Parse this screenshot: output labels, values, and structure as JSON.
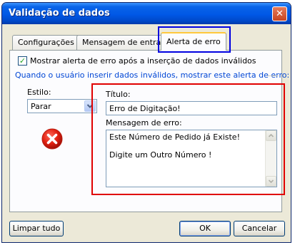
{
  "window": {
    "title": "Validação de dados",
    "close_symbol": "✕"
  },
  "tabs": [
    {
      "label": "Configurações",
      "active": false
    },
    {
      "label": "Mensagem de entrada",
      "active": false
    },
    {
      "label": "Alerta de erro",
      "active": true
    }
  ],
  "error_alert": {
    "checkbox_label": "Mostrar alerta de erro após a inserção de dados inválidos",
    "checkbox_checked": true,
    "group_caption": "Quando o usuário inserir dados inválidos, mostrar este alerta de erro:",
    "style_label": "Estilo:",
    "style_value": "Parar",
    "title_label": "Título:",
    "title_value": "Erro de Digitação!",
    "message_label": "Mensagem de erro:",
    "message_lines": [
      "Este Número de Pedido já Existe!",
      "Digite um Outro Número !"
    ]
  },
  "buttons": {
    "clear_all": "Limpar tudo",
    "ok": "OK",
    "cancel": "Cancelar"
  },
  "colors": {
    "highlight_red": "#e00000",
    "highlight_blue": "#0000e0",
    "title_bar": "#0058e6",
    "dialog_bg": "#ece9d8"
  }
}
